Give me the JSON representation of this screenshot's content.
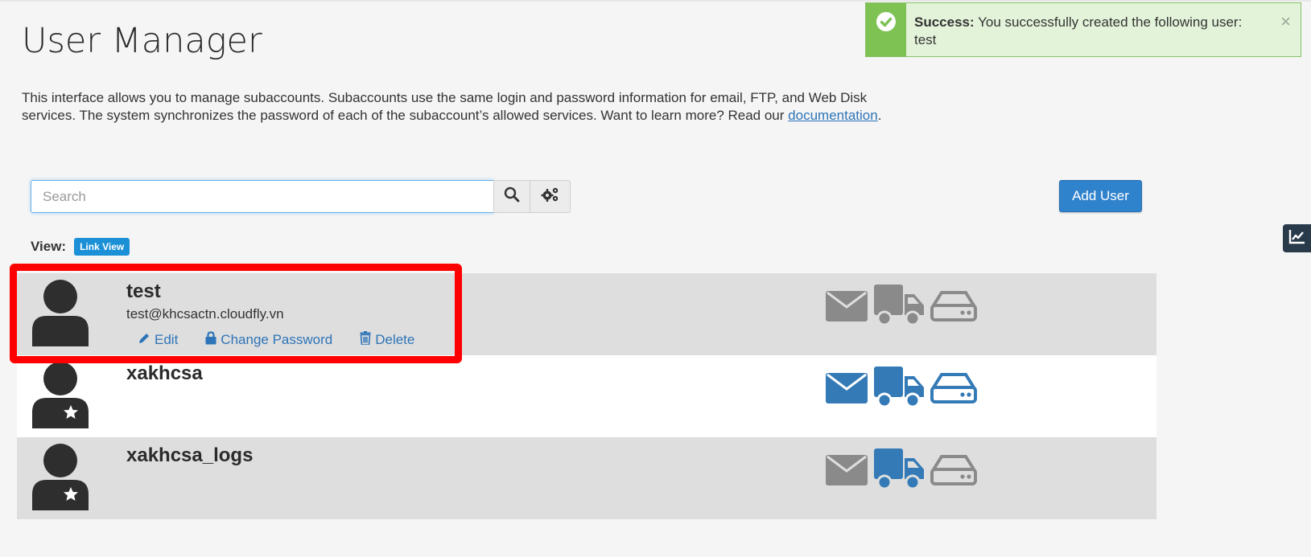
{
  "page": {
    "title": "User Manager",
    "intro_text": "This interface allows you to manage subaccounts. Subaccounts use the same login and password information for email, FTP, and Web Disk services. The system synchronizes the password of each of the subaccount’s allowed services. Want to learn more? Read our",
    "intro_link": "documentation",
    "intro_end": "."
  },
  "alert": {
    "label": "Success:",
    "message": "You successfully created the following user: test",
    "close": "×",
    "color": "#7ec254"
  },
  "search": {
    "placeholder": "Search"
  },
  "toolbar": {
    "add_user_label": "Add User"
  },
  "view": {
    "label": "View:",
    "mode": "Link View"
  },
  "actions": {
    "edit": "Edit",
    "change_password": "Change Password",
    "delete": "Delete"
  },
  "colors": {
    "service_enabled": "#337ab7",
    "service_disabled": "#8a8a8a",
    "accent": "#2f82cc"
  },
  "users": [
    {
      "name": "test",
      "email": "test@khcsactn.cloudfly.vn",
      "avatar": "user-icon",
      "services": {
        "email": false,
        "ftp": false,
        "webdisk": false
      }
    },
    {
      "name": "xakhcsa",
      "email": "",
      "avatar": "user-star-icon",
      "services": {
        "email": true,
        "ftp": true,
        "webdisk": true
      }
    },
    {
      "name": "xakhcsa_logs",
      "email": "",
      "avatar": "user-star-icon",
      "services": {
        "email": false,
        "ftp": true,
        "webdisk": false
      }
    }
  ]
}
